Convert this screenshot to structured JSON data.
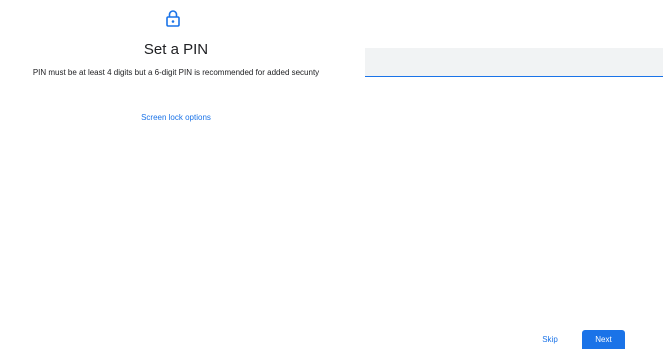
{
  "header": {
    "icon": "lock-icon",
    "title": "Set a PIN",
    "description": "PIN must be at least 4 digits but a 6-digit PIN is recommended for added secunty"
  },
  "links": {
    "lock_options": "Screen lock options"
  },
  "pin_input": {
    "value": "",
    "placeholder": ""
  },
  "footer": {
    "skip_label": "Skip",
    "next_label": "Next"
  },
  "colors": {
    "accent": "#1a73e8",
    "field_background": "#f1f3f4",
    "text": "#202124",
    "background": "#ffffff"
  }
}
